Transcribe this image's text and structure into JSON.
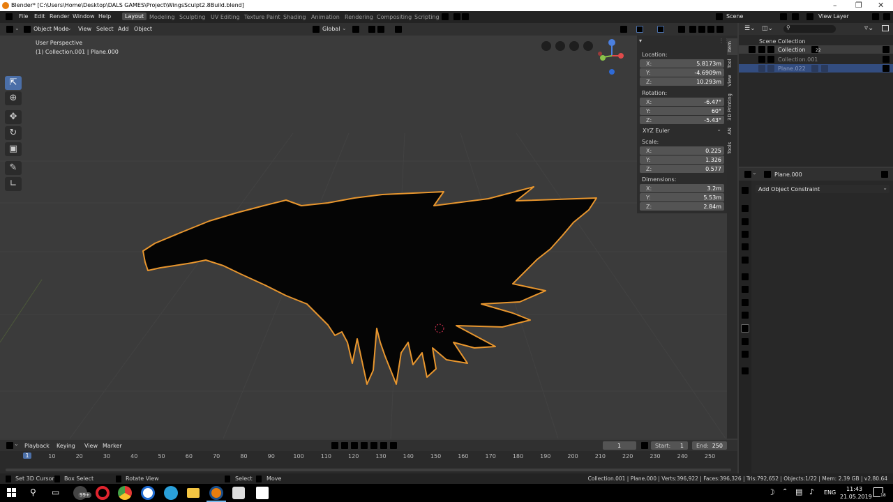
{
  "window": {
    "title": "Blender* [C:\\Users\\Home\\Desktop\\DALS GAMES\\Project\\WingsSculpt2.8Build.blend]"
  },
  "menu": {
    "items": [
      "File",
      "Edit",
      "Render",
      "Window",
      "Help"
    ]
  },
  "workspaces": [
    "Layout",
    "Modeling",
    "Sculpting",
    "UV Editing",
    "Texture Paint",
    "Shading",
    "Animation",
    "Rendering",
    "Compositing",
    "Scripting"
  ],
  "scene": {
    "scene_label": "Scene",
    "view_layer_label": "View Layer"
  },
  "viewport_header": {
    "mode": "Object Mode",
    "menus": [
      "View",
      "Select",
      "Add",
      "Object"
    ],
    "orientation": "Global"
  },
  "viewport": {
    "perspective_label": "User Perspective",
    "object_info": "(1) Collection.001 | Plane.000"
  },
  "npanel": {
    "location_label": "Location:",
    "location": {
      "x": "5.8173m",
      "y": "-4.6909m",
      "z": "10.293m"
    },
    "rotation_label": "Rotation:",
    "rotation": {
      "x": "-6.47°",
      "y": "60°",
      "z": "-5.43°"
    },
    "rotation_mode": "XYZ Euler",
    "scale_label": "Scale:",
    "scale": {
      "x": "0.225",
      "y": "1.326",
      "z": "0.577"
    },
    "dimensions_label": "Dimensions:",
    "dimensions": {
      "x": "3.2m",
      "y": "5.53m",
      "z": "2.84m"
    },
    "tabs": [
      "Item",
      "Tool",
      "View",
      "3D Printing",
      "AN",
      "Tools"
    ]
  },
  "outliner": {
    "root": "Scene Collection",
    "items": [
      "Collection",
      "Collection.001",
      "Plane.022"
    ],
    "badge": "22"
  },
  "properties": {
    "object_name": "Plane.000",
    "add_constraint": "Add Object Constraint"
  },
  "timeline": {
    "menus": [
      "Playback",
      "Keying",
      "View",
      "Marker"
    ],
    "current_frame": "1",
    "start_label": "Start:",
    "start": "1",
    "end_label": "End:",
    "end": "250",
    "ticks": [
      "1",
      "10",
      "20",
      "30",
      "40",
      "50",
      "60",
      "70",
      "80",
      "90",
      "100",
      "110",
      "120",
      "130",
      "140",
      "150",
      "160",
      "170",
      "180",
      "190",
      "200",
      "210",
      "220",
      "230",
      "240",
      "250"
    ]
  },
  "status": {
    "hints": [
      "Set 3D Cursor",
      "Box Select",
      "Rotate View",
      "Select",
      "Move"
    ],
    "stats": "Collection.001 | Plane.000 | Verts:396,922 | Faces:396,326 | Tris:792,652 | Objects:1/22 | Mem: 2.39 GB | v2.80.64"
  },
  "taskbar": {
    "lang": "ENG",
    "time": "11:43",
    "date": "21.05.2019",
    "badge": "99+",
    "notif": "18"
  },
  "colors": {
    "accent": "#4b6fa8",
    "outline": "#e8962e",
    "selected_row": "#334d80"
  }
}
